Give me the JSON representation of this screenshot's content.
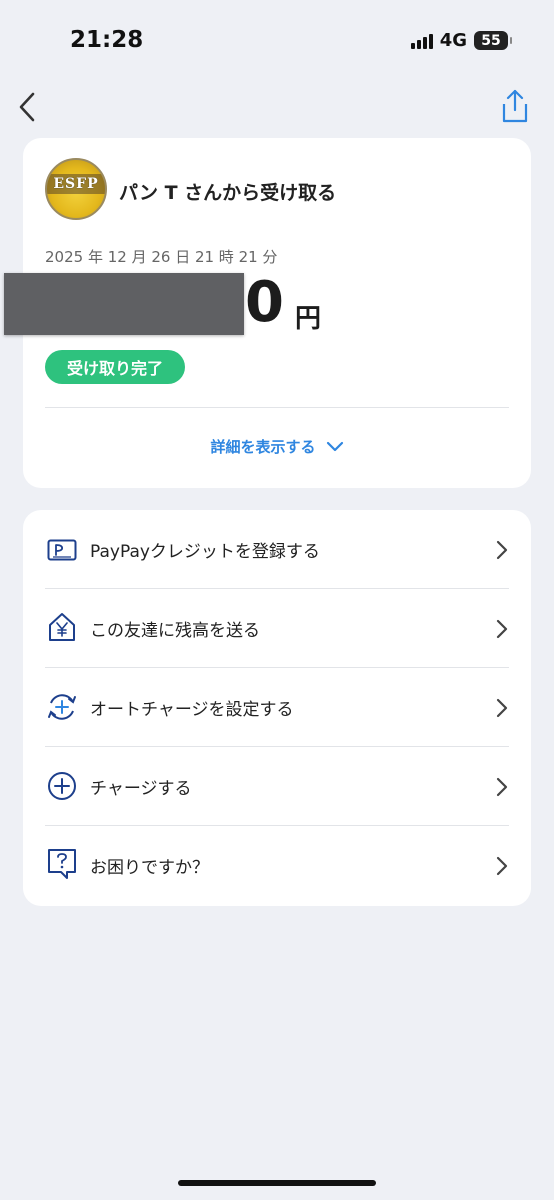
{
  "status_bar": {
    "time": "21:28",
    "network": "4G",
    "battery": "55"
  },
  "nav": {
    "back_icon": "chevron-left-icon",
    "share_icon": "share-icon"
  },
  "receipt": {
    "avatar_text": "ESFP",
    "title": "パン T さんから受け取る",
    "date": "2025 年 12 月 26 日 21 時 21 分",
    "amount_visible": "0",
    "amount_unit": "円",
    "status": "受け取り完了",
    "details_label": "詳細を表示する",
    "accent_color": "#2f86e0",
    "status_color": "#2ec27e"
  },
  "actions": [
    {
      "label": "PayPayクレジットを登録する",
      "icon": "credit-card-icon"
    },
    {
      "label": "この友達に残高を送る",
      "icon": "yen-house-icon"
    },
    {
      "label": "オートチャージを設定する",
      "icon": "auto-charge-icon"
    },
    {
      "label": "チャージする",
      "icon": "plus-circle-icon"
    },
    {
      "label": "お困りですか？",
      "icon": "help-chat-icon"
    }
  ]
}
